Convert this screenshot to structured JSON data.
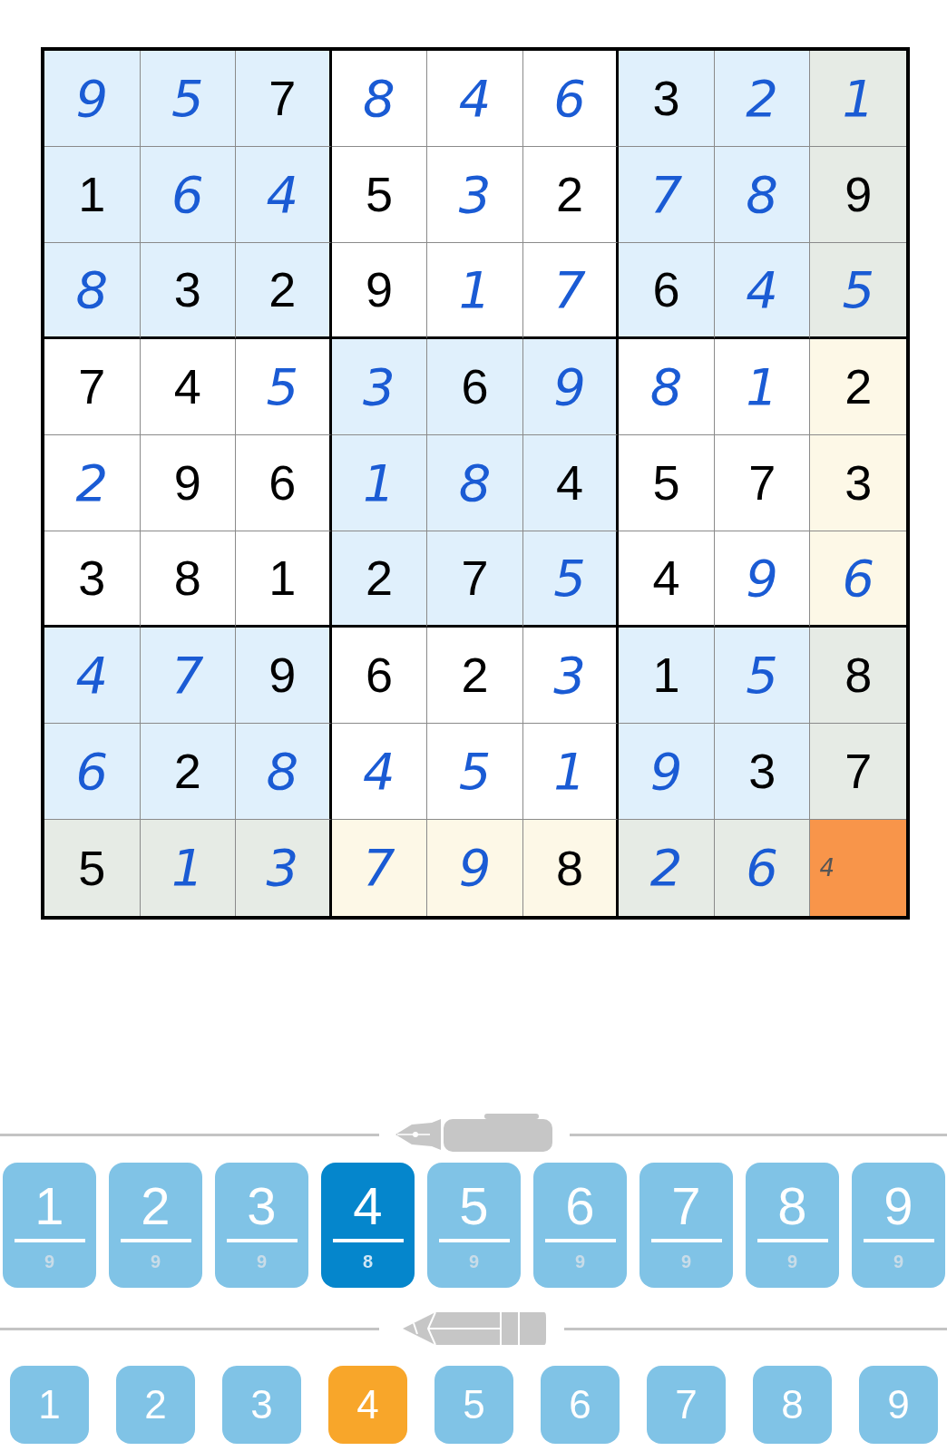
{
  "grid": {
    "rows": [
      {
        "cells": [
          {
            "value": "9",
            "given": false,
            "color": "#e0f0fc"
          },
          {
            "value": "5",
            "given": false,
            "color": "#e0f0fc"
          },
          {
            "value": "7",
            "given": true,
            "color": "#e0f0fc"
          },
          {
            "value": "8",
            "given": false,
            "color": "#ffffff"
          },
          {
            "value": "4",
            "given": false,
            "color": "#ffffff"
          },
          {
            "value": "6",
            "given": false,
            "color": "#ffffff"
          },
          {
            "value": "3",
            "given": true,
            "color": "#e0f0fc"
          },
          {
            "value": "2",
            "given": false,
            "color": "#e0f0fc"
          },
          {
            "value": "1",
            "given": false,
            "color": "#e6ebe5"
          }
        ]
      },
      {
        "cells": [
          {
            "value": "1",
            "given": true,
            "color": "#e0f0fc"
          },
          {
            "value": "6",
            "given": false,
            "color": "#e0f0fc"
          },
          {
            "value": "4",
            "given": false,
            "color": "#e0f0fc"
          },
          {
            "value": "5",
            "given": true,
            "color": "#ffffff"
          },
          {
            "value": "3",
            "given": false,
            "color": "#ffffff"
          },
          {
            "value": "2",
            "given": true,
            "color": "#ffffff"
          },
          {
            "value": "7",
            "given": false,
            "color": "#e0f0fc"
          },
          {
            "value": "8",
            "given": false,
            "color": "#e0f0fc"
          },
          {
            "value": "9",
            "given": true,
            "color": "#e6ebe5"
          }
        ]
      },
      {
        "cells": [
          {
            "value": "8",
            "given": false,
            "color": "#e0f0fc"
          },
          {
            "value": "3",
            "given": true,
            "color": "#e0f0fc"
          },
          {
            "value": "2",
            "given": true,
            "color": "#e0f0fc"
          },
          {
            "value": "9",
            "given": true,
            "color": "#ffffff"
          },
          {
            "value": "1",
            "given": false,
            "color": "#ffffff"
          },
          {
            "value": "7",
            "given": false,
            "color": "#ffffff"
          },
          {
            "value": "6",
            "given": true,
            "color": "#e0f0fc"
          },
          {
            "value": "4",
            "given": false,
            "color": "#e0f0fc"
          },
          {
            "value": "5",
            "given": false,
            "color": "#e6ebe5"
          }
        ]
      },
      {
        "cells": [
          {
            "value": "7",
            "given": true,
            "color": "#ffffff"
          },
          {
            "value": "4",
            "given": true,
            "color": "#ffffff"
          },
          {
            "value": "5",
            "given": false,
            "color": "#ffffff"
          },
          {
            "value": "3",
            "given": false,
            "color": "#e0f0fc"
          },
          {
            "value": "6",
            "given": true,
            "color": "#e0f0fc"
          },
          {
            "value": "9",
            "given": false,
            "color": "#e0f0fc"
          },
          {
            "value": "8",
            "given": false,
            "color": "#ffffff"
          },
          {
            "value": "1",
            "given": false,
            "color": "#ffffff"
          },
          {
            "value": "2",
            "given": true,
            "color": "#fdf8e7"
          }
        ]
      },
      {
        "cells": [
          {
            "value": "2",
            "given": false,
            "color": "#ffffff"
          },
          {
            "value": "9",
            "given": true,
            "color": "#ffffff"
          },
          {
            "value": "6",
            "given": true,
            "color": "#ffffff"
          },
          {
            "value": "1",
            "given": false,
            "color": "#e0f0fc"
          },
          {
            "value": "8",
            "given": false,
            "color": "#e0f0fc"
          },
          {
            "value": "4",
            "given": true,
            "color": "#e0f0fc"
          },
          {
            "value": "5",
            "given": true,
            "color": "#ffffff"
          },
          {
            "value": "7",
            "given": true,
            "color": "#ffffff"
          },
          {
            "value": "3",
            "given": true,
            "color": "#fdf8e7"
          }
        ]
      },
      {
        "cells": [
          {
            "value": "3",
            "given": true,
            "color": "#ffffff"
          },
          {
            "value": "8",
            "given": true,
            "color": "#ffffff"
          },
          {
            "value": "1",
            "given": true,
            "color": "#ffffff"
          },
          {
            "value": "2",
            "given": true,
            "color": "#e0f0fc"
          },
          {
            "value": "7",
            "given": true,
            "color": "#e0f0fc"
          },
          {
            "value": "5",
            "given": false,
            "color": "#e0f0fc"
          },
          {
            "value": "4",
            "given": true,
            "color": "#ffffff"
          },
          {
            "value": "9",
            "given": false,
            "color": "#ffffff"
          },
          {
            "value": "6",
            "given": false,
            "color": "#fdf8e7"
          }
        ]
      },
      {
        "cells": [
          {
            "value": "4",
            "given": false,
            "color": "#e0f0fc"
          },
          {
            "value": "7",
            "given": false,
            "color": "#e0f0fc"
          },
          {
            "value": "9",
            "given": true,
            "color": "#e0f0fc"
          },
          {
            "value": "6",
            "given": true,
            "color": "#ffffff"
          },
          {
            "value": "2",
            "given": true,
            "color": "#ffffff"
          },
          {
            "value": "3",
            "given": false,
            "color": "#ffffff"
          },
          {
            "value": "1",
            "given": true,
            "color": "#e0f0fc"
          },
          {
            "value": "5",
            "given": false,
            "color": "#e0f0fc"
          },
          {
            "value": "8",
            "given": true,
            "color": "#e6ebe5"
          }
        ]
      },
      {
        "cells": [
          {
            "value": "6",
            "given": false,
            "color": "#e0f0fc"
          },
          {
            "value": "2",
            "given": true,
            "color": "#e0f0fc"
          },
          {
            "value": "8",
            "given": false,
            "color": "#e0f0fc"
          },
          {
            "value": "4",
            "given": false,
            "color": "#ffffff"
          },
          {
            "value": "5",
            "given": false,
            "color": "#ffffff"
          },
          {
            "value": "1",
            "given": false,
            "color": "#ffffff"
          },
          {
            "value": "9",
            "given": false,
            "color": "#e0f0fc"
          },
          {
            "value": "3",
            "given": true,
            "color": "#e0f0fc"
          },
          {
            "value": "7",
            "given": true,
            "color": "#e6ebe5"
          }
        ]
      },
      {
        "cells": [
          {
            "value": "5",
            "given": true,
            "color": "#e6ebe5"
          },
          {
            "value": "1",
            "given": false,
            "color": "#e6ebe5"
          },
          {
            "value": "3",
            "given": false,
            "color": "#e6ebe5"
          },
          {
            "value": "7",
            "given": false,
            "color": "#fdf8e7"
          },
          {
            "value": "9",
            "given": false,
            "color": "#fdf8e7"
          },
          {
            "value": "8",
            "given": true,
            "color": "#fdf8e7"
          },
          {
            "value": "2",
            "given": false,
            "color": "#e6ebe5"
          },
          {
            "value": "6",
            "given": false,
            "color": "#e6ebe5"
          },
          {
            "note": "4",
            "color": "#f8954a"
          }
        ]
      }
    ]
  },
  "pen_buttons": [
    {
      "digit": "1",
      "count": "9",
      "selected": false
    },
    {
      "digit": "2",
      "count": "9",
      "selected": false
    },
    {
      "digit": "3",
      "count": "9",
      "selected": false
    },
    {
      "digit": "4",
      "count": "8",
      "selected": true
    },
    {
      "digit": "5",
      "count": "9",
      "selected": false
    },
    {
      "digit": "6",
      "count": "9",
      "selected": false
    },
    {
      "digit": "7",
      "count": "9",
      "selected": false
    },
    {
      "digit": "8",
      "count": "9",
      "selected": false
    },
    {
      "digit": "9",
      "count": "9",
      "selected": false
    }
  ],
  "pencil_buttons": [
    {
      "digit": "1",
      "selected": false
    },
    {
      "digit": "2",
      "selected": false
    },
    {
      "digit": "3",
      "selected": false
    },
    {
      "digit": "4",
      "selected": true
    },
    {
      "digit": "5",
      "selected": false
    },
    {
      "digit": "6",
      "selected": false
    },
    {
      "digit": "7",
      "selected": false
    },
    {
      "digit": "8",
      "selected": false
    },
    {
      "digit": "9",
      "selected": false
    }
  ]
}
